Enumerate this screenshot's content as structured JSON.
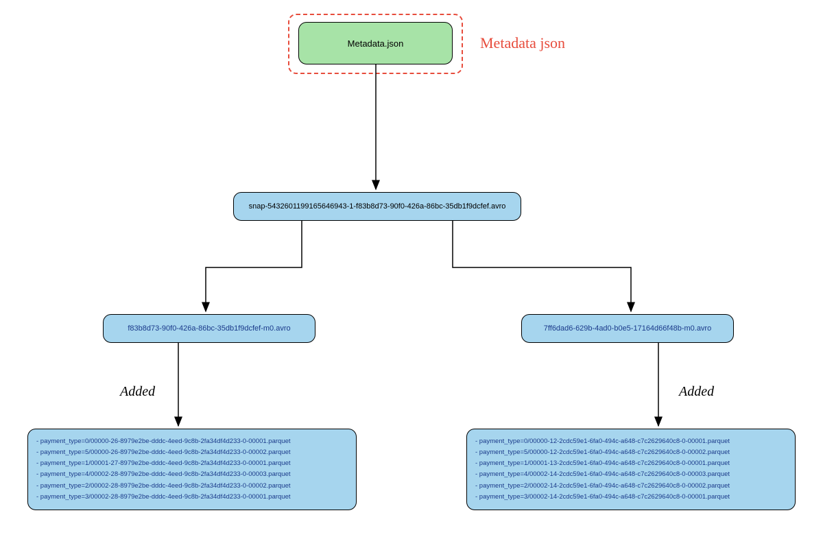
{
  "metadata_node": {
    "label": "Metadata.json"
  },
  "metadata_annotation": "Metadata json",
  "snap_node": {
    "label": "snap-5432601199165646943-1-f83b8d73-90f0-426a-86bc-35db1f9dcfef.avro"
  },
  "avro_left": {
    "label": "f83b8d73-90f0-426a-86bc-35db1f9dcfef-m0.avro"
  },
  "avro_right": {
    "label": "7ff6dad6-629b-4ad0-b0e5-17164d66f48b-m0.avro"
  },
  "added_label_left": "Added",
  "added_label_right": "Added",
  "parquet_left": {
    "lines": [
      "- payment_type=0/00000-26-8979e2be-dddc-4eed-9c8b-2fa34df4d233-0-00001.parquet",
      "- payment_type=5/00000-26-8979e2be-dddc-4eed-9c8b-2fa34df4d233-0-00002.parquet",
      "- payment_type=1/00001-27-8979e2be-dddc-4eed-9c8b-2fa34df4d233-0-00001.parquet",
      "- payment_type=4/00002-28-8979e2be-dddc-4eed-9c8b-2fa34df4d233-0-00003.parquet",
      "- payment_type=2/00002-28-8979e2be-dddc-4eed-9c8b-2fa34df4d233-0-00002.parquet",
      "- payment_type=3/00002-28-8979e2be-dddc-4eed-9c8b-2fa34df4d233-0-00001.parquet"
    ]
  },
  "parquet_right": {
    "lines": [
      "- payment_type=0/00000-12-2cdc59e1-6fa0-494c-a648-c7c2629640c8-0-00001.parquet",
      "- payment_type=5/00000-12-2cdc59e1-6fa0-494c-a648-c7c2629640c8-0-00002.parquet",
      "- payment_type=1/00001-13-2cdc59e1-6fa0-494c-a648-c7c2629640c8-0-00001.parquet",
      "- payment_type=4/00002-14-2cdc59e1-6fa0-494c-a648-c7c2629640c8-0-00003.parquet",
      "- payment_type=2/00002-14-2cdc59e1-6fa0-494c-a648-c7c2629640c8-0-00002.parquet",
      "- payment_type=3/00002-14-2cdc59e1-6fa0-494c-a648-c7c2629640c8-0-00001.parquet"
    ]
  }
}
